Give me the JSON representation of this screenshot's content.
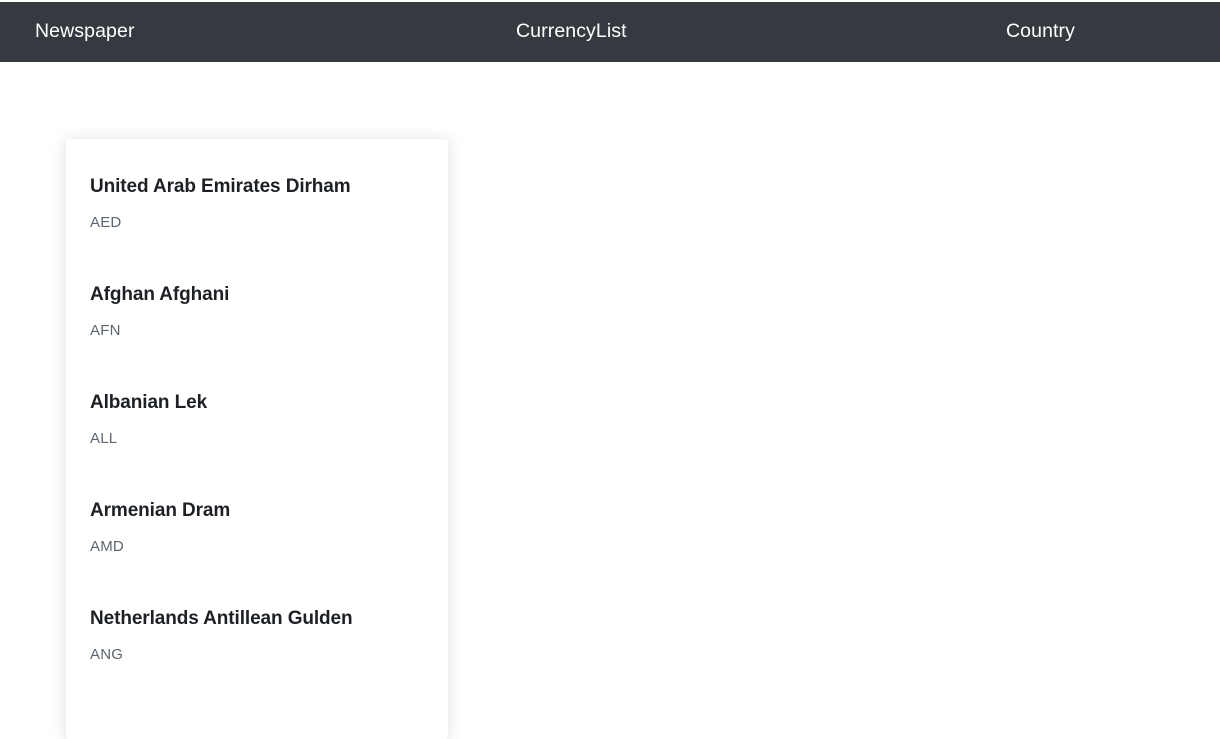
{
  "navbar": {
    "brand": "Newspaper",
    "background_color": "#343a40",
    "text_color": "#ffffff",
    "links": [
      {
        "label": "CurrencyList"
      },
      {
        "label": "Country"
      }
    ]
  },
  "card": {
    "background_color": "#ffffff",
    "items": [
      {
        "name": "United Arab Emirates Dirham",
        "code": "AED"
      },
      {
        "name": "Afghan Afghani",
        "code": "AFN"
      },
      {
        "name": "Albanian Lek",
        "code": "ALL"
      },
      {
        "name": "Armenian Dram",
        "code": "AMD"
      },
      {
        "name": "Netherlands Antillean Gulden",
        "code": "ANG"
      }
    ]
  }
}
